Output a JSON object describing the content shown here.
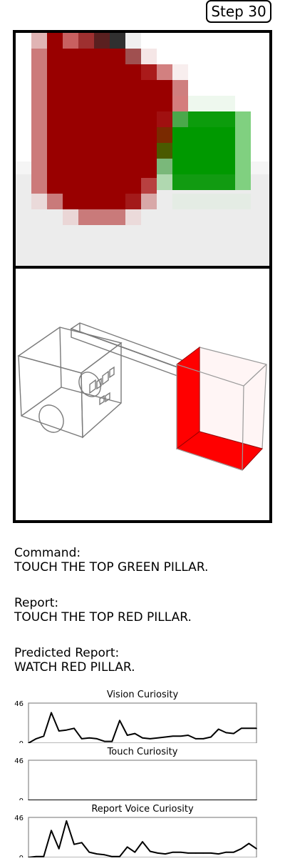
{
  "step_label": "Step 30",
  "command": {
    "label": "Command:",
    "text": "TOUCH THE TOP GREEN PILLAR."
  },
  "report": {
    "label": "Report:",
    "text": "TOUCH THE TOP RED PILLAR."
  },
  "predicted_report": {
    "label": "Predicted Report:",
    "text": "WATCH RED PILLAR."
  },
  "colors": {
    "red_object": "#990000",
    "green_object": "#009900",
    "floor": "#eeeeee",
    "model_red": "#ff0000"
  },
  "chart_data": [
    {
      "type": "line",
      "title": "Vision Curiosity",
      "ylim": [
        0,
        46
      ],
      "yticks": [
        "46",
        "0"
      ],
      "grid": false,
      "series": [
        {
          "values": [
            0,
            5,
            8,
            35,
            14,
            15,
            17,
            5,
            6,
            5,
            2,
            2,
            26,
            9,
            11,
            6,
            5,
            6,
            7,
            8,
            8,
            9,
            5,
            5,
            7,
            16,
            12,
            11,
            17,
            17,
            17
          ]
        }
      ]
    },
    {
      "type": "line",
      "title": "Touch Curiosity",
      "ylim": [
        0,
        46
      ],
      "yticks": [
        "46",
        "0"
      ],
      "grid": false,
      "series": [
        {
          "values": [
            0,
            0,
            0,
            0,
            0,
            0,
            0,
            0,
            0,
            0,
            0,
            0,
            0,
            0,
            0,
            0,
            0,
            0,
            0,
            0,
            0,
            0,
            0,
            0,
            0,
            0,
            0,
            0,
            0,
            0,
            0
          ]
        }
      ]
    },
    {
      "type": "line",
      "title": "Report Voice Curiosity",
      "ylim": [
        0,
        46
      ],
      "yticks": [
        "46",
        "0"
      ],
      "grid": false,
      "series": [
        {
          "values": [
            0,
            1,
            1,
            31,
            10,
            42,
            15,
            17,
            6,
            4,
            3,
            1,
            1,
            12,
            6,
            18,
            7,
            5,
            4,
            6,
            6,
            5,
            5,
            5,
            5,
            4,
            6,
            6,
            10,
            16,
            10
          ]
        }
      ]
    }
  ]
}
